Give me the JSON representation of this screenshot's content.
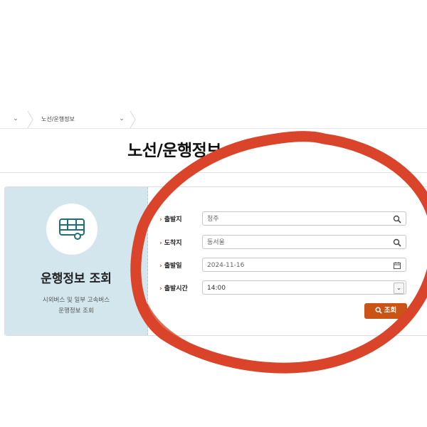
{
  "breadcrumb": {
    "home_icon": "chevron-down-icon",
    "current": "노선/운행정보",
    "dropdown_icon": "chevron-down-icon"
  },
  "page": {
    "title": "노선/운행정보"
  },
  "info_panel": {
    "icon": "bus-icon",
    "title": "운행정보 조회",
    "desc_line1": "시외버스 및 일부 고속버스",
    "desc_line2": "운행정보 조회"
  },
  "form": {
    "departure": {
      "label": "출발지",
      "value": "청주",
      "icon": "search-icon"
    },
    "arrival": {
      "label": "도착지",
      "value": "동서울",
      "icon": "search-icon"
    },
    "date": {
      "label": "출발일",
      "value": "2024-11-16",
      "icon": "calendar-icon"
    },
    "time": {
      "label": "출발시간",
      "value": "14:00",
      "icon": "chevron-down-icon"
    },
    "submit_label": "조회"
  },
  "colors": {
    "accent": "#c95416",
    "panel_bg": "#d3e6ed",
    "annotation_red": "#d9442a"
  }
}
